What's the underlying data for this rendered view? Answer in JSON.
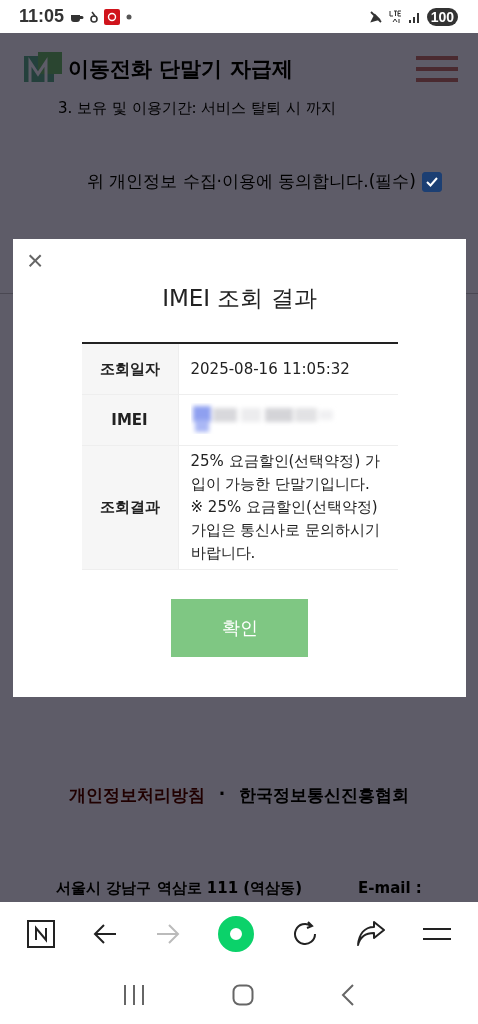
{
  "status_bar": {
    "time": "11:05",
    "battery": "100"
  },
  "page": {
    "logo_text": "이동전화 단말기 자급제",
    "retention_text": "3. 보유 및 이용기간: 서비스 탈퇴 시 까지",
    "consent": {
      "label": "위 개인정보 수집·이용에 동의합니다.(필수)",
      "checked": true
    },
    "footer_links": [
      "개인정보처리방침",
      "한국정보통신진흥협회"
    ],
    "footer_separator": "·",
    "address": "서울시 강남구 역삼로 111 (역삼동)",
    "email_label": "E-mail :"
  },
  "modal": {
    "close": "×",
    "title": "IMEI 조회 결과",
    "rows": [
      {
        "label": "조회일자",
        "kind": "text",
        "value": "2025-08-16 11:05:32"
      },
      {
        "label": "IMEI",
        "kind": "blurred"
      },
      {
        "label": "조회결과",
        "kind": "text",
        "value": "25% 요금할인(선택약정) 가입이 가능한 단말기입니다.\n※ 25% 요금할인(선택약정) 가입은 통신사로 문의하시기 바랍니다."
      }
    ],
    "button": "확인"
  },
  "browser_toolbar": {
    "forward_enabled": false
  }
}
